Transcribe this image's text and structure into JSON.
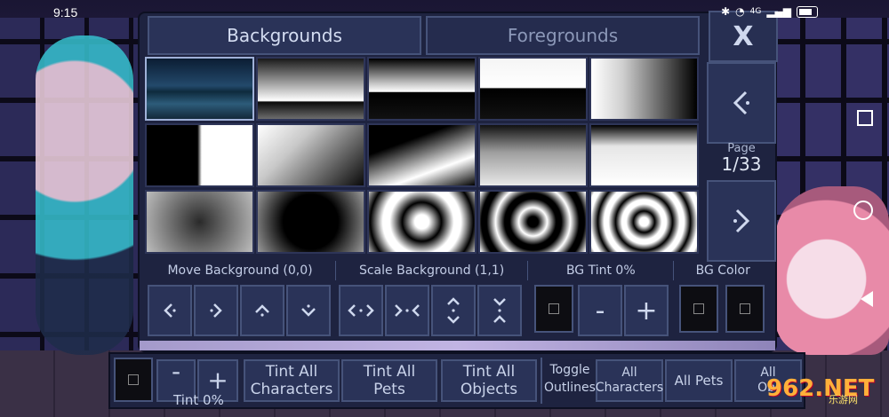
{
  "status_bar": {
    "time": "9:15",
    "signal_text": "4G"
  },
  "tabs": [
    {
      "label": "Backgrounds",
      "active": true
    },
    {
      "label": "Foregrounds",
      "active": false
    }
  ],
  "close_label": "X",
  "pagination": {
    "label": "Page",
    "value": "1/33"
  },
  "background_thumbnails": [
    {
      "type": "city-night",
      "selected": true
    },
    {
      "type": "gradient-dark-top"
    },
    {
      "type": "gradient-horizon-top"
    },
    {
      "type": "gradient-bottom-dark"
    },
    {
      "type": "gradient-left-light"
    },
    {
      "type": "split-vertical"
    },
    {
      "type": "gradient-diagonal"
    },
    {
      "type": "perspective-floor"
    },
    {
      "type": "perspective-floor-soft"
    },
    {
      "type": "perspective-floor-light"
    },
    {
      "type": "radial-soft"
    },
    {
      "type": "radial-dark-center"
    },
    {
      "type": "radial-rings-2"
    },
    {
      "type": "radial-rings-3"
    },
    {
      "type": "radial-rings-4"
    }
  ],
  "categories": {
    "move": "Move Background (0,0)",
    "scale": "Scale Background (1,1)",
    "tint": "BG Tint 0%",
    "color": "BG Color"
  },
  "tint_controls": {
    "minus": "-",
    "plus": "+"
  },
  "bottom_bar": {
    "tint_label": "Tint 0%",
    "minus": "-",
    "plus": "+",
    "tint_all_characters": "Tint All\nCharacters",
    "tint_all_pets": "Tint All\nPets",
    "tint_all_objects": "Tint All\nObjects",
    "toggle_outlines": "Toggle\nOutlines",
    "all_characters": "All\nCharacters",
    "all_pets": "All Pets",
    "all_objects": "All\nObj"
  },
  "watermark": {
    "main": "962.NET",
    "sub": "乐游网"
  },
  "colors": {
    "panel": "#1e2340",
    "button": "#2a3358",
    "border": "#46537a",
    "accent": "#c1b4e3"
  }
}
